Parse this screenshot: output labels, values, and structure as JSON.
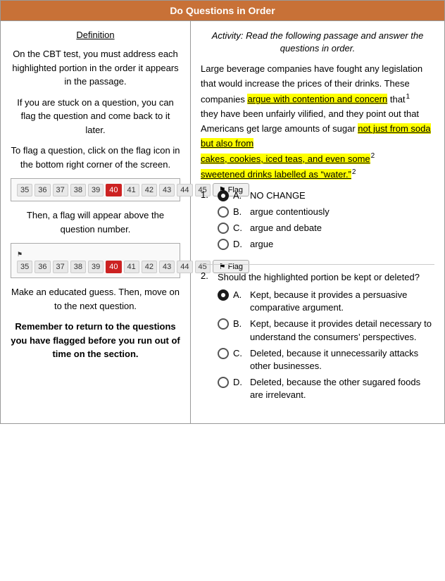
{
  "title": "Do Questions in Order",
  "left": {
    "header": "Definition",
    "paragraphs": [
      "On the CBT test, you must address each highlighted portion in the order it appears in the passage.",
      "If you are stuck on a question, you can flag the question and come back to it later.",
      "To flag a question, click on the flag icon in the bottom right corner of the screen."
    ],
    "flagBar1": {
      "numbers": [
        "35",
        "36",
        "37",
        "38",
        "39",
        "40",
        "41",
        "42",
        "43",
        "44",
        "45"
      ],
      "active": "40",
      "flagLabel": "Flag"
    },
    "afterFlag1": "Then, a flag will appear above the question number.",
    "flagBar2": {
      "numbers": [
        "35",
        "36",
        "37",
        "38",
        "39",
        "40",
        "41",
        "42",
        "43",
        "44",
        "45"
      ],
      "active": "40",
      "flagLabel": "Flag",
      "showIndicator": true
    },
    "afterFlag2": "Make an educated guess. Then, move on to the next question.",
    "reminder": "Remember to return to the questions you have flagged before you run out of time on the section."
  },
  "right": {
    "header": "Activity: Read the following passage and answer the questions in order.",
    "passage": {
      "part1": "Large beverage companies have fought any legislation that would increase the prices of their drinks. These companies ",
      "highlight1": "argue with contention and concern",
      "between1": " that",
      "sup1": "1",
      "part2": "they have been unfairly vilified, and they point out that Americans get large amounts of sugar ",
      "highlight2": "not just from soda but also from",
      "sup2_after_line": "",
      "highlight3": "cakes, cookies, iced teas, and even some",
      "sup3": "2",
      "highlight4": "sweetened drinks labelled as “water.”",
      "sup4": "2"
    },
    "questions": [
      {
        "number": "1.",
        "intro": "",
        "answers": [
          {
            "letter": "A.",
            "text": "NO CHANGE",
            "selected": true
          },
          {
            "letter": "B.",
            "text": "argue contentiously",
            "selected": false
          },
          {
            "letter": "C.",
            "text": "argue and debate",
            "selected": false
          },
          {
            "letter": "D.",
            "text": "argue",
            "selected": false
          }
        ]
      },
      {
        "number": "2.",
        "intro": "Should the highlighted portion be kept or deleted?",
        "answers": [
          {
            "letter": "A.",
            "text": "Kept, because it provides a persuasive comparative argument.",
            "selected": true
          },
          {
            "letter": "B.",
            "text": "Kept, because it provides detail necessary to understand the consumers’ perspectives.",
            "selected": false
          },
          {
            "letter": "C.",
            "text": "Deleted, because it unnecessarily attacks other businesses.",
            "selected": false
          },
          {
            "letter": "D.",
            "text": "Deleted, because the other sugared foods are irrelevant.",
            "selected": false
          }
        ]
      }
    ]
  }
}
